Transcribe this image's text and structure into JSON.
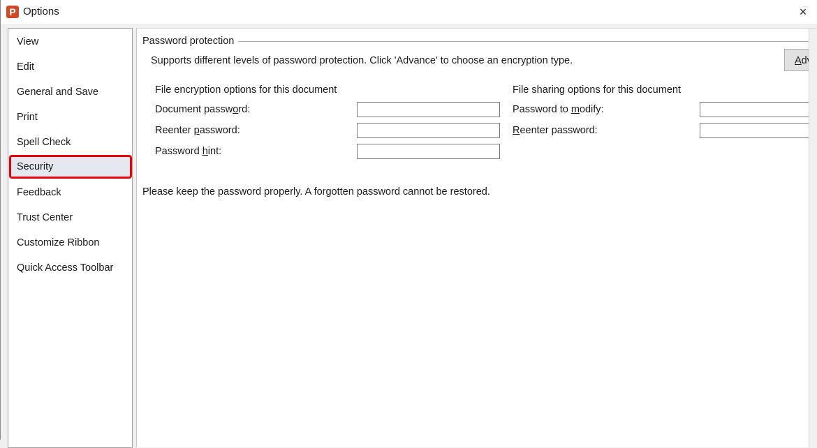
{
  "window": {
    "title": "Options",
    "app_icon": "P",
    "app_icon_color": "#d24726",
    "close_icon": "×"
  },
  "sidebar": {
    "items": [
      {
        "label": "View"
      },
      {
        "label": "Edit"
      },
      {
        "label": "General and Save"
      },
      {
        "label": "Print"
      },
      {
        "label": "Spell Check"
      },
      {
        "label": "Security",
        "active": true
      },
      {
        "label": "Feedback"
      },
      {
        "label": "Trust Center"
      },
      {
        "label": "Customize Ribbon"
      },
      {
        "label": "Quick Access Toolbar"
      }
    ],
    "highlight_color": "#e8000b"
  },
  "main": {
    "group_title": "Password protection",
    "description": "Supports different levels of password protection. Click 'Advance' to choose an encryption type.",
    "advance_button": {
      "prefix": "A",
      "rest": "dv"
    },
    "encryption": {
      "title": "File encryption options for this document",
      "fields": [
        {
          "label_a": "Document passw",
          "label_u": "o",
          "label_b": "rd:",
          "value": ""
        },
        {
          "label_a": "Reenter ",
          "label_u": "p",
          "label_b": "assword:",
          "value": ""
        },
        {
          "label_a": "Password ",
          "label_u": "h",
          "label_b": "int:",
          "value": ""
        }
      ]
    },
    "sharing": {
      "title": "File sharing options for this document",
      "fields": [
        {
          "label_a": "Password to ",
          "label_u": "m",
          "label_b": "odify:",
          "value": ""
        },
        {
          "label_a": "",
          "label_u": "R",
          "label_b": "eenter password:",
          "value": ""
        }
      ]
    },
    "note": "Please keep the password properly. A forgotten password cannot be restored."
  }
}
